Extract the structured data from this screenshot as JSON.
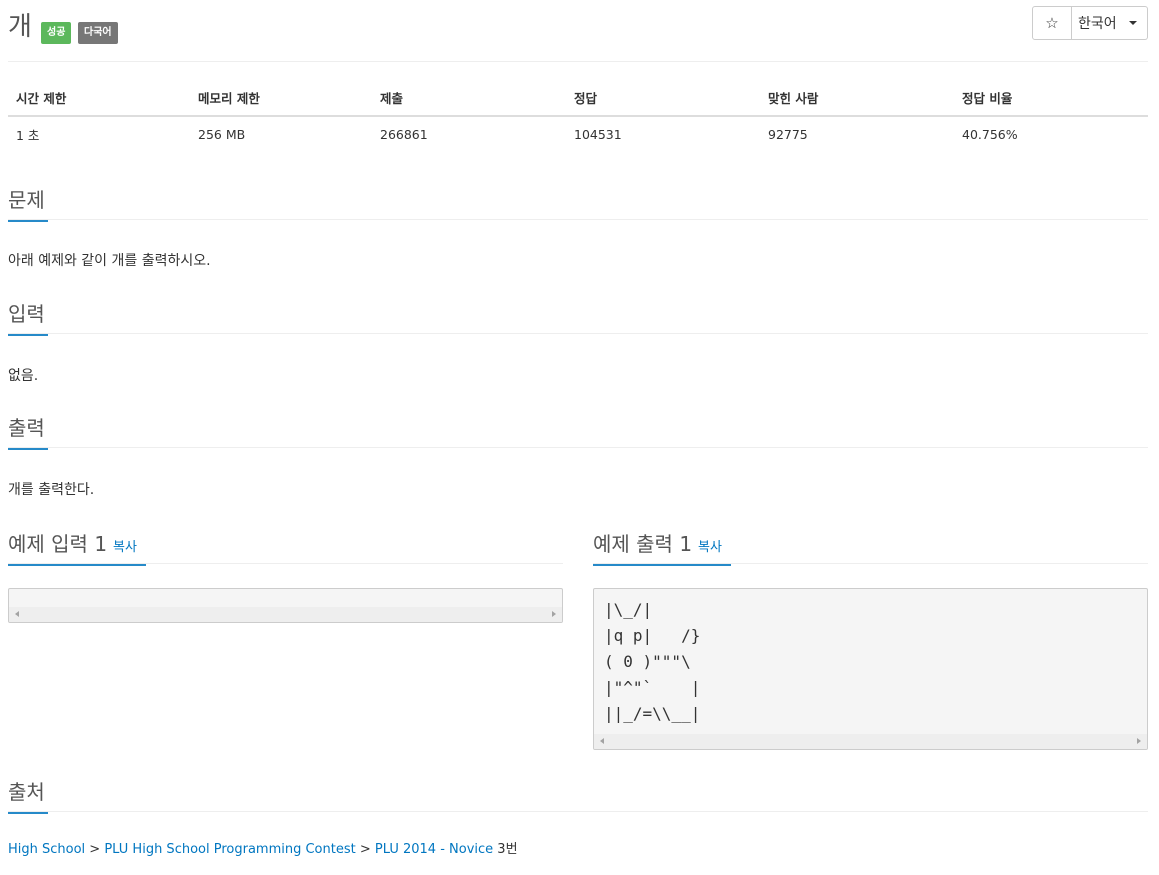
{
  "problem": {
    "title": "개",
    "badges": [
      "성공",
      "다국어"
    ],
    "star_icon": "star-icon",
    "language_label": "한국어"
  },
  "info_table": {
    "headers": [
      "시간 제한",
      "메모리 제한",
      "제출",
      "정답",
      "맞힌 사람",
      "정답 비율"
    ],
    "values": [
      "1 초",
      "256 MB",
      "266861",
      "104531",
      "92775",
      "40.756%"
    ]
  },
  "sections": {
    "problem_title": "문제",
    "problem_text": "아래 예제와 같이 개를 출력하시오.",
    "input_title": "입력",
    "input_text": "없음.",
    "output_title": "출력",
    "output_text": "개를 출력한다.",
    "sample_input_title": "예제 입력 1",
    "sample_output_title": "예제 출력 1",
    "copy_label": "복사",
    "sample_input": "",
    "sample_output": "|\\_/|\n|q p|   /}\n( 0 )\"\"\"\\\n|\"^\"`    |\n||_/=\\\\__|",
    "source_title": "출처"
  },
  "source": {
    "links": [
      "High School",
      "PLU High School Programming Contest",
      "PLU 2014 - Novice"
    ],
    "separator": " > ",
    "suffix": "3번"
  },
  "colors": {
    "success": "#5cb85c",
    "default_badge": "#777777",
    "link": "#0076c0",
    "heading": "#555555"
  }
}
